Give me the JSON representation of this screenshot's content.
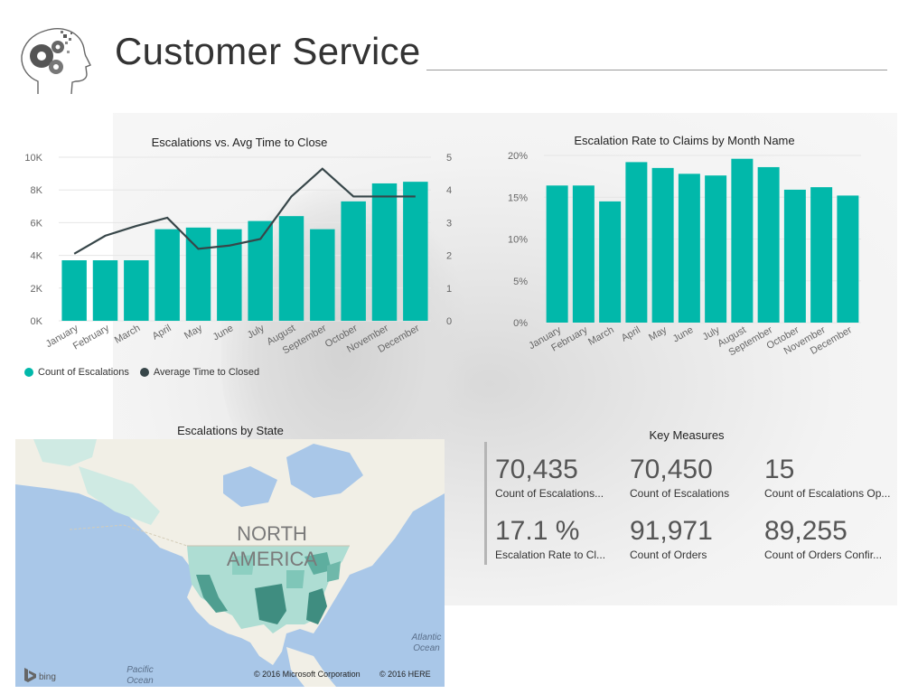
{
  "header": {
    "title": "Customer Service"
  },
  "colors": {
    "teal": "#01B8AA",
    "line": "#374649",
    "map_water": "#A9C7E8",
    "map_land": "#F1EFE6"
  },
  "escalations_chart": {
    "title": "Escalations vs. Avg Time to Close"
  },
  "rate_chart": {
    "title": "Escalation Rate to Claims by Month Name"
  },
  "legend": {
    "items": [
      "Count of Escalations",
      "Average Time to Closed"
    ]
  },
  "map": {
    "title": "Escalations by State",
    "region_label_1": "NORTH",
    "region_label_2": "AMERICA",
    "ocean_atlantic_1": "Atlantic",
    "ocean_atlantic_2": "Ocean",
    "ocean_pacific_1": "Pacific",
    "ocean_pacific_2": "Ocean",
    "brand": "bing",
    "copyright_1": "© 2016 Microsoft Corporation",
    "copyright_2": "© 2016 HERE"
  },
  "key_measures": {
    "title": "Key Measures",
    "cards": [
      {
        "value": "70,435",
        "label": "Count of Escalations..."
      },
      {
        "value": "70,450",
        "label": "Count of Escalations"
      },
      {
        "value": "15",
        "label": "Count of Escalations Op..."
      },
      {
        "value": "17.1 %",
        "label": "Escalation Rate to Cl..."
      },
      {
        "value": "91,971",
        "label": "Count of Orders"
      },
      {
        "value": "89,255",
        "label": "Count of Orders Confir..."
      }
    ]
  },
  "chart_data": [
    {
      "type": "bar",
      "title": "Escalations vs. Avg Time to Close",
      "categories": [
        "January",
        "February",
        "March",
        "April",
        "May",
        "June",
        "July",
        "August",
        "September",
        "October",
        "November",
        "December"
      ],
      "series": [
        {
          "name": "Count of Escalations",
          "type": "bar",
          "axis": "left",
          "values": [
            3700,
            3700,
            3700,
            5600,
            5700,
            5600,
            6100,
            6400,
            5600,
            7300,
            8400,
            8500
          ]
        },
        {
          "name": "Average Time to Closed",
          "type": "line",
          "axis": "right",
          "values": [
            2.05,
            2.6,
            2.9,
            3.15,
            2.2,
            2.3,
            2.5,
            3.8,
            4.65,
            3.8,
            3.8,
            3.8
          ]
        }
      ],
      "yticks_left": [
        "0K",
        "2K",
        "4K",
        "6K",
        "8K",
        "10K"
      ],
      "ylim_left": [
        0,
        10000
      ],
      "yticks_right": [
        "0",
        "1",
        "2",
        "3",
        "4",
        "5"
      ],
      "ylim_right": [
        0,
        5
      ],
      "legend": "bottom-left",
      "grid": true
    },
    {
      "type": "bar",
      "title": "Escalation Rate to Claims by Month Name",
      "categories": [
        "January",
        "February",
        "March",
        "April",
        "May",
        "June",
        "July",
        "August",
        "September",
        "October",
        "November",
        "December"
      ],
      "values": [
        16.4,
        16.4,
        14.5,
        19.2,
        18.5,
        17.8,
        17.6,
        19.6,
        18.6,
        15.9,
        16.2,
        15.2
      ],
      "yticks": [
        "0%",
        "5%",
        "10%",
        "15%",
        "20%"
      ],
      "ylim": [
        0,
        20
      ],
      "grid": true
    }
  ]
}
